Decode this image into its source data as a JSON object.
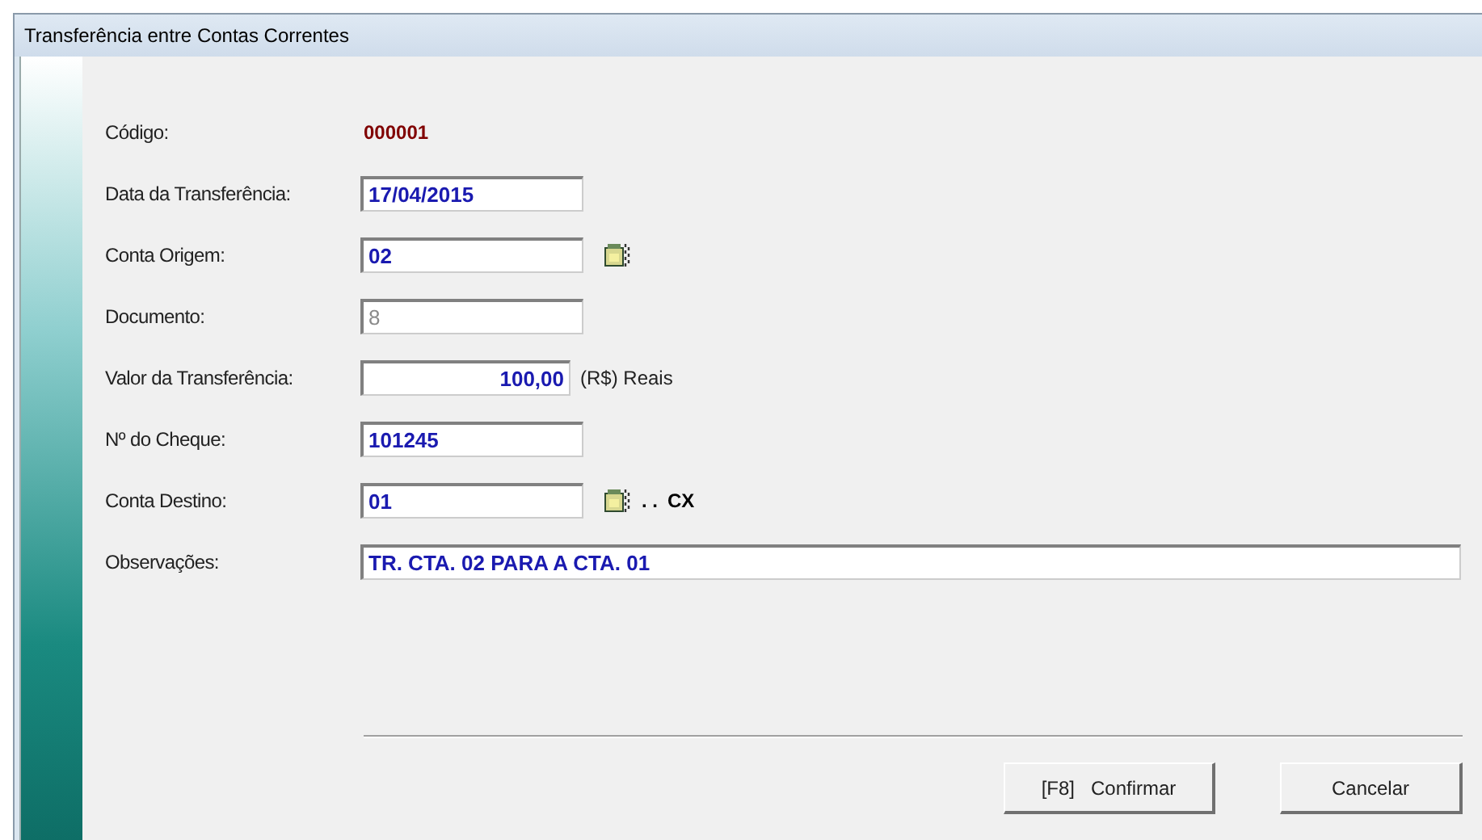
{
  "window": {
    "title": "Transferência entre Contas Correntes"
  },
  "fields": [
    {
      "kind": "display",
      "label": "Código:",
      "value": "000001"
    },
    {
      "kind": "input",
      "label": "Data da Transferência:",
      "value": "17/04/2015",
      "disabled": false
    },
    {
      "kind": "input",
      "label": "Conta Origem:",
      "value": "02",
      "disabled": false,
      "lookup": true
    },
    {
      "kind": "input",
      "label": "Documento:",
      "value": "8",
      "disabled": true
    },
    {
      "kind": "amount",
      "label": "Valor da Transferência:",
      "value": "100,00",
      "disabled": false,
      "suffix": "(R$) Reais"
    },
    {
      "kind": "input",
      "label": "Nº do Cheque:",
      "value": "101245",
      "disabled": false
    },
    {
      "kind": "input",
      "label": "Conta Destino:",
      "value": "01",
      "disabled": false,
      "lookup": true,
      "dots": ". .",
      "account_name": "CX"
    },
    {
      "kind": "notes",
      "label": "Observações:",
      "value": "TR. CTA. 02 PARA A CTA. 01",
      "disabled": false
    }
  ],
  "buttons": [
    {
      "label": "[F8]   Confirmar"
    },
    {
      "label": "Cancelar"
    }
  ]
}
